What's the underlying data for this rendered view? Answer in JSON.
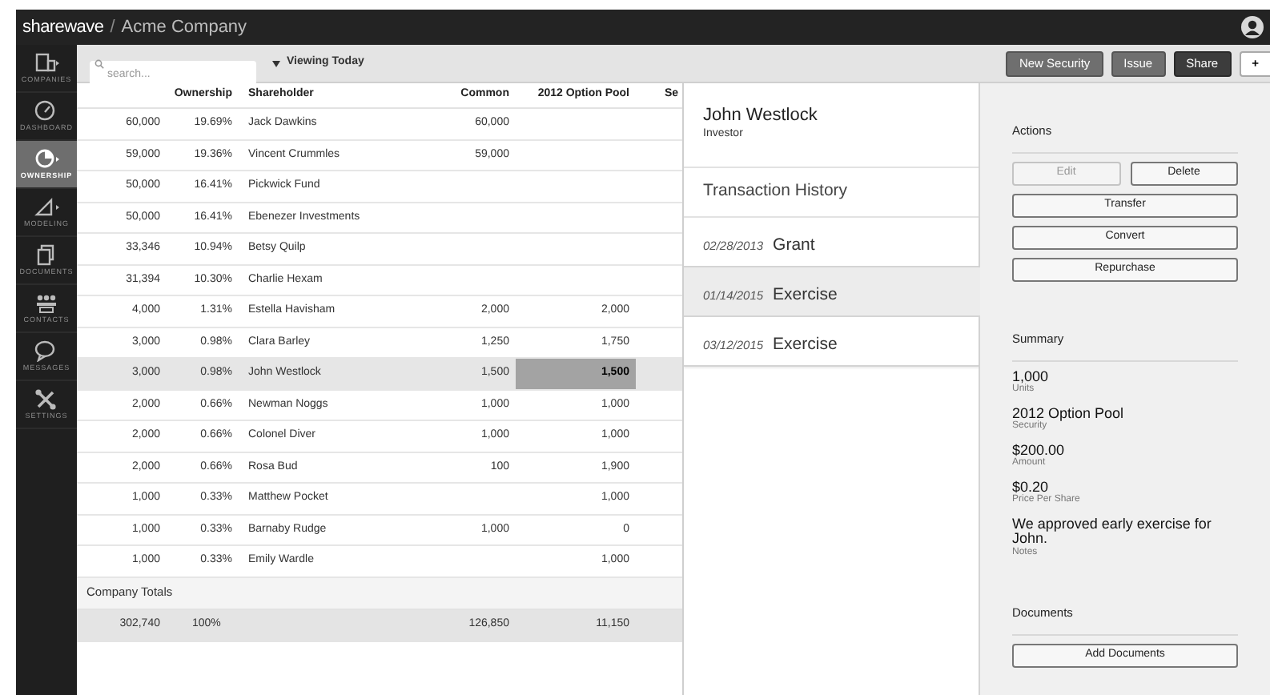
{
  "top_bar": {
    "brand": "sharewave",
    "separator": "/",
    "company": "Acme Company"
  },
  "sidebar": {
    "items": [
      {
        "label": "COMPANIES",
        "selected": false
      },
      {
        "label": "DASHBOARD",
        "selected": false
      },
      {
        "label": "OWNERSHIP",
        "selected": true
      },
      {
        "label": "MODELING",
        "selected": false
      },
      {
        "label": "DOCUMENTS",
        "selected": false
      },
      {
        "label": "CONTACTS",
        "selected": false
      },
      {
        "label": "MESSAGES",
        "selected": false
      },
      {
        "label": "SETTINGS",
        "selected": false
      }
    ]
  },
  "toolbar": {
    "search": {
      "placeholder": "search..."
    },
    "view_filter": "Viewing Today",
    "buttons": [
      {
        "label": "New Security",
        "kind": "medium"
      },
      {
        "label": "Issue",
        "kind": "medium"
      },
      {
        "label": "Share",
        "kind": "dark"
      },
      {
        "label": "+",
        "kind": "light"
      }
    ]
  },
  "table": {
    "columns": {
      "ownership": "Ownership",
      "shareholder": "Shareholder",
      "common": "Common",
      "option_pool": "2012 Option Pool",
      "column_6": "Se"
    },
    "rows": [
      {
        "total": "60,000",
        "ownership": "19.69%",
        "shareholder": "Jack Dawkins",
        "common": "60,000",
        "selected": false
      },
      {
        "total": "59,000",
        "ownership": "19.36%",
        "shareholder": "Vincent Crummles",
        "common": "59,000",
        "selected": false
      },
      {
        "total": "50,000",
        "ownership": "16.41%",
        "shareholder": "Pickwick Fund",
        "selected": false
      },
      {
        "total": "50,000",
        "ownership": "16.41%",
        "shareholder": "Ebenezer Investments",
        "selected": false
      },
      {
        "total": "33,346",
        "ownership": "10.94%",
        "shareholder": "Betsy Quilp",
        "selected": false
      },
      {
        "total": "31,394",
        "ownership": "10.30%",
        "shareholder": "Charlie Hexam",
        "selected": false
      },
      {
        "total": "4,000",
        "ownership": "1.31%",
        "shareholder": "Estella Havisham",
        "common": "2,000",
        "option_pool": "2,000",
        "selected": false
      },
      {
        "total": "3,000",
        "ownership": "0.98%",
        "shareholder": "Clara Barley",
        "common": "1,250",
        "option_pool": "1,750",
        "selected": false
      },
      {
        "total": "3,000",
        "ownership": "0.98%",
        "shareholder": "John Westlock",
        "common": "1,500",
        "option_pool": "1,500",
        "selected": true
      },
      {
        "total": "2,000",
        "ownership": "0.66%",
        "shareholder": "Newman Noggs",
        "common": "1,000",
        "option_pool": "1,000",
        "selected": false
      },
      {
        "total": "2,000",
        "ownership": "0.66%",
        "shareholder": "Colonel Diver",
        "common": "1,000",
        "option_pool": "1,000",
        "selected": false
      },
      {
        "total": "2,000",
        "ownership": "0.66%",
        "shareholder": "Rosa Bud",
        "common": "100",
        "option_pool": "1,900",
        "selected": false
      },
      {
        "total": "1,000",
        "ownership": "0.33%",
        "shareholder": "Matthew Pocket",
        "option_pool": "1,000",
        "selected": false
      },
      {
        "total": "1,000",
        "ownership": "0.33%",
        "shareholder": "Barnaby Rudge",
        "common": "1,000",
        "option_pool": "0",
        "selected": false
      },
      {
        "total": "1,000",
        "ownership": "0.33%",
        "shareholder": "Emily Wardle",
        "option_pool": "1,000",
        "selected": false
      }
    ],
    "totals_label": "Company Totals",
    "totals": {
      "total": "302,740",
      "ownership": "100%",
      "common": "126,850",
      "option_pool": "11,150"
    }
  },
  "holder": {
    "name": "John Westlock",
    "role": "Investor",
    "history_title": "Transaction History",
    "transactions": [
      {
        "date": "02/28/2013",
        "type": "Grant",
        "selected": false
      },
      {
        "date": "01/14/2015",
        "type": "Exercise",
        "selected": true
      },
      {
        "date": "03/12/2015",
        "type": "Exercise",
        "selected": false
      }
    ]
  },
  "details": {
    "actions_title": "Actions",
    "actions": [
      {
        "label": "Edit",
        "disabled": true,
        "kind": "half"
      },
      {
        "label": "Delete",
        "disabled": false,
        "kind": "half"
      },
      {
        "label": "Transfer",
        "disabled": false,
        "kind": "full"
      },
      {
        "label": "Convert",
        "disabled": false,
        "kind": "full"
      },
      {
        "label": "Repurchase",
        "disabled": false,
        "kind": "full"
      }
    ],
    "summary_title": "Summary",
    "summary": [
      {
        "value": "1,000",
        "label": "Units"
      },
      {
        "value": "2012 Option Pool",
        "label": "Security"
      },
      {
        "value": "$200.00",
        "label": "Amount"
      },
      {
        "value": "$0.20",
        "label": "Price Per Share"
      },
      {
        "value": "We approved early exercise for John.",
        "label": "Notes"
      }
    ],
    "documents_title": "Documents",
    "documents_button": "Add Documents"
  }
}
